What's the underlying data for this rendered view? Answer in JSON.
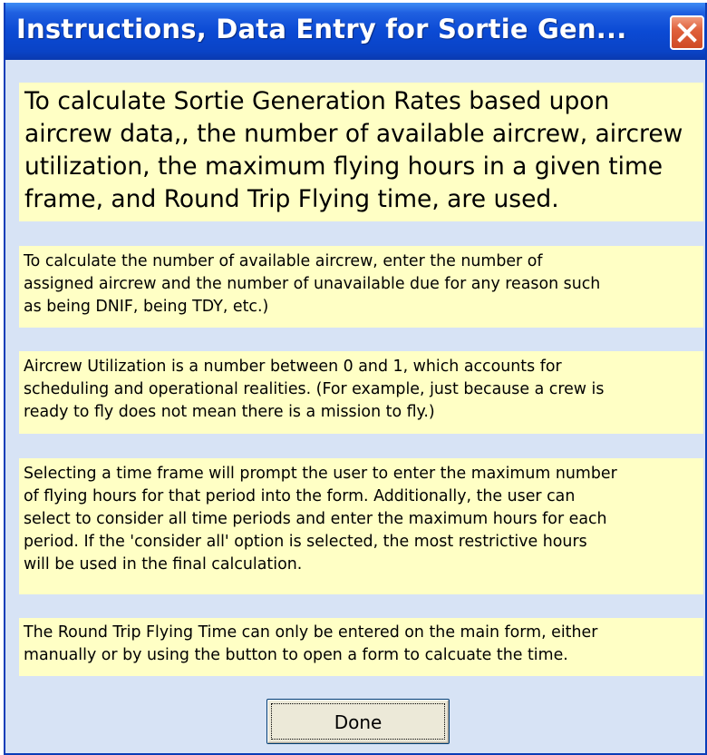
{
  "window": {
    "title": "Instructions, Data Entry for Sortie Gen...",
    "close_icon": "close-x-icon"
  },
  "colors": {
    "title_bar": "#0b4ad4",
    "window_background": "#d7e3f5",
    "panel_background": "#ffffc5",
    "close_button": "#e0623d",
    "button_face": "#ece9d8"
  },
  "panels": [
    {
      "lines": [
        "To calculate Sortie Generation Rates based upon",
        "aircrew data,, the number of available aircrew, aircrew",
        "utilization, the maximum flying hours in a given time",
        "frame, and Round Trip Flying time, are used."
      ]
    },
    {
      "lines": [
        "To calculate the number of available aircrew, enter the number of",
        "assigned aircrew and the number of unavailable due for any reason such",
        "as being DNIF, being TDY, etc.)"
      ]
    },
    {
      "lines": [
        "Aircrew Utilization is a number between 0 and 1, which accounts for",
        "scheduling and operational realities.  (For example, just because a crew is",
        "ready to fly does not mean there is a mission to fly.)"
      ]
    },
    {
      "lines": [
        "Selecting a time frame will prompt the user to enter the maximum number",
        "of flying hours for that period into the form.  Additionally, the user can",
        "select to consider all time periods and enter the maximum hours for each",
        "period.  If the 'consider all' option is selected, the most restrictive hours",
        "will be used in the final calculation."
      ]
    },
    {
      "lines": [
        "The Round Trip Flying Time can only be entered on the main form, either",
        "manually or by using the button to open a form to calcuate the time."
      ]
    }
  ],
  "buttons": {
    "done_label": "Done"
  }
}
